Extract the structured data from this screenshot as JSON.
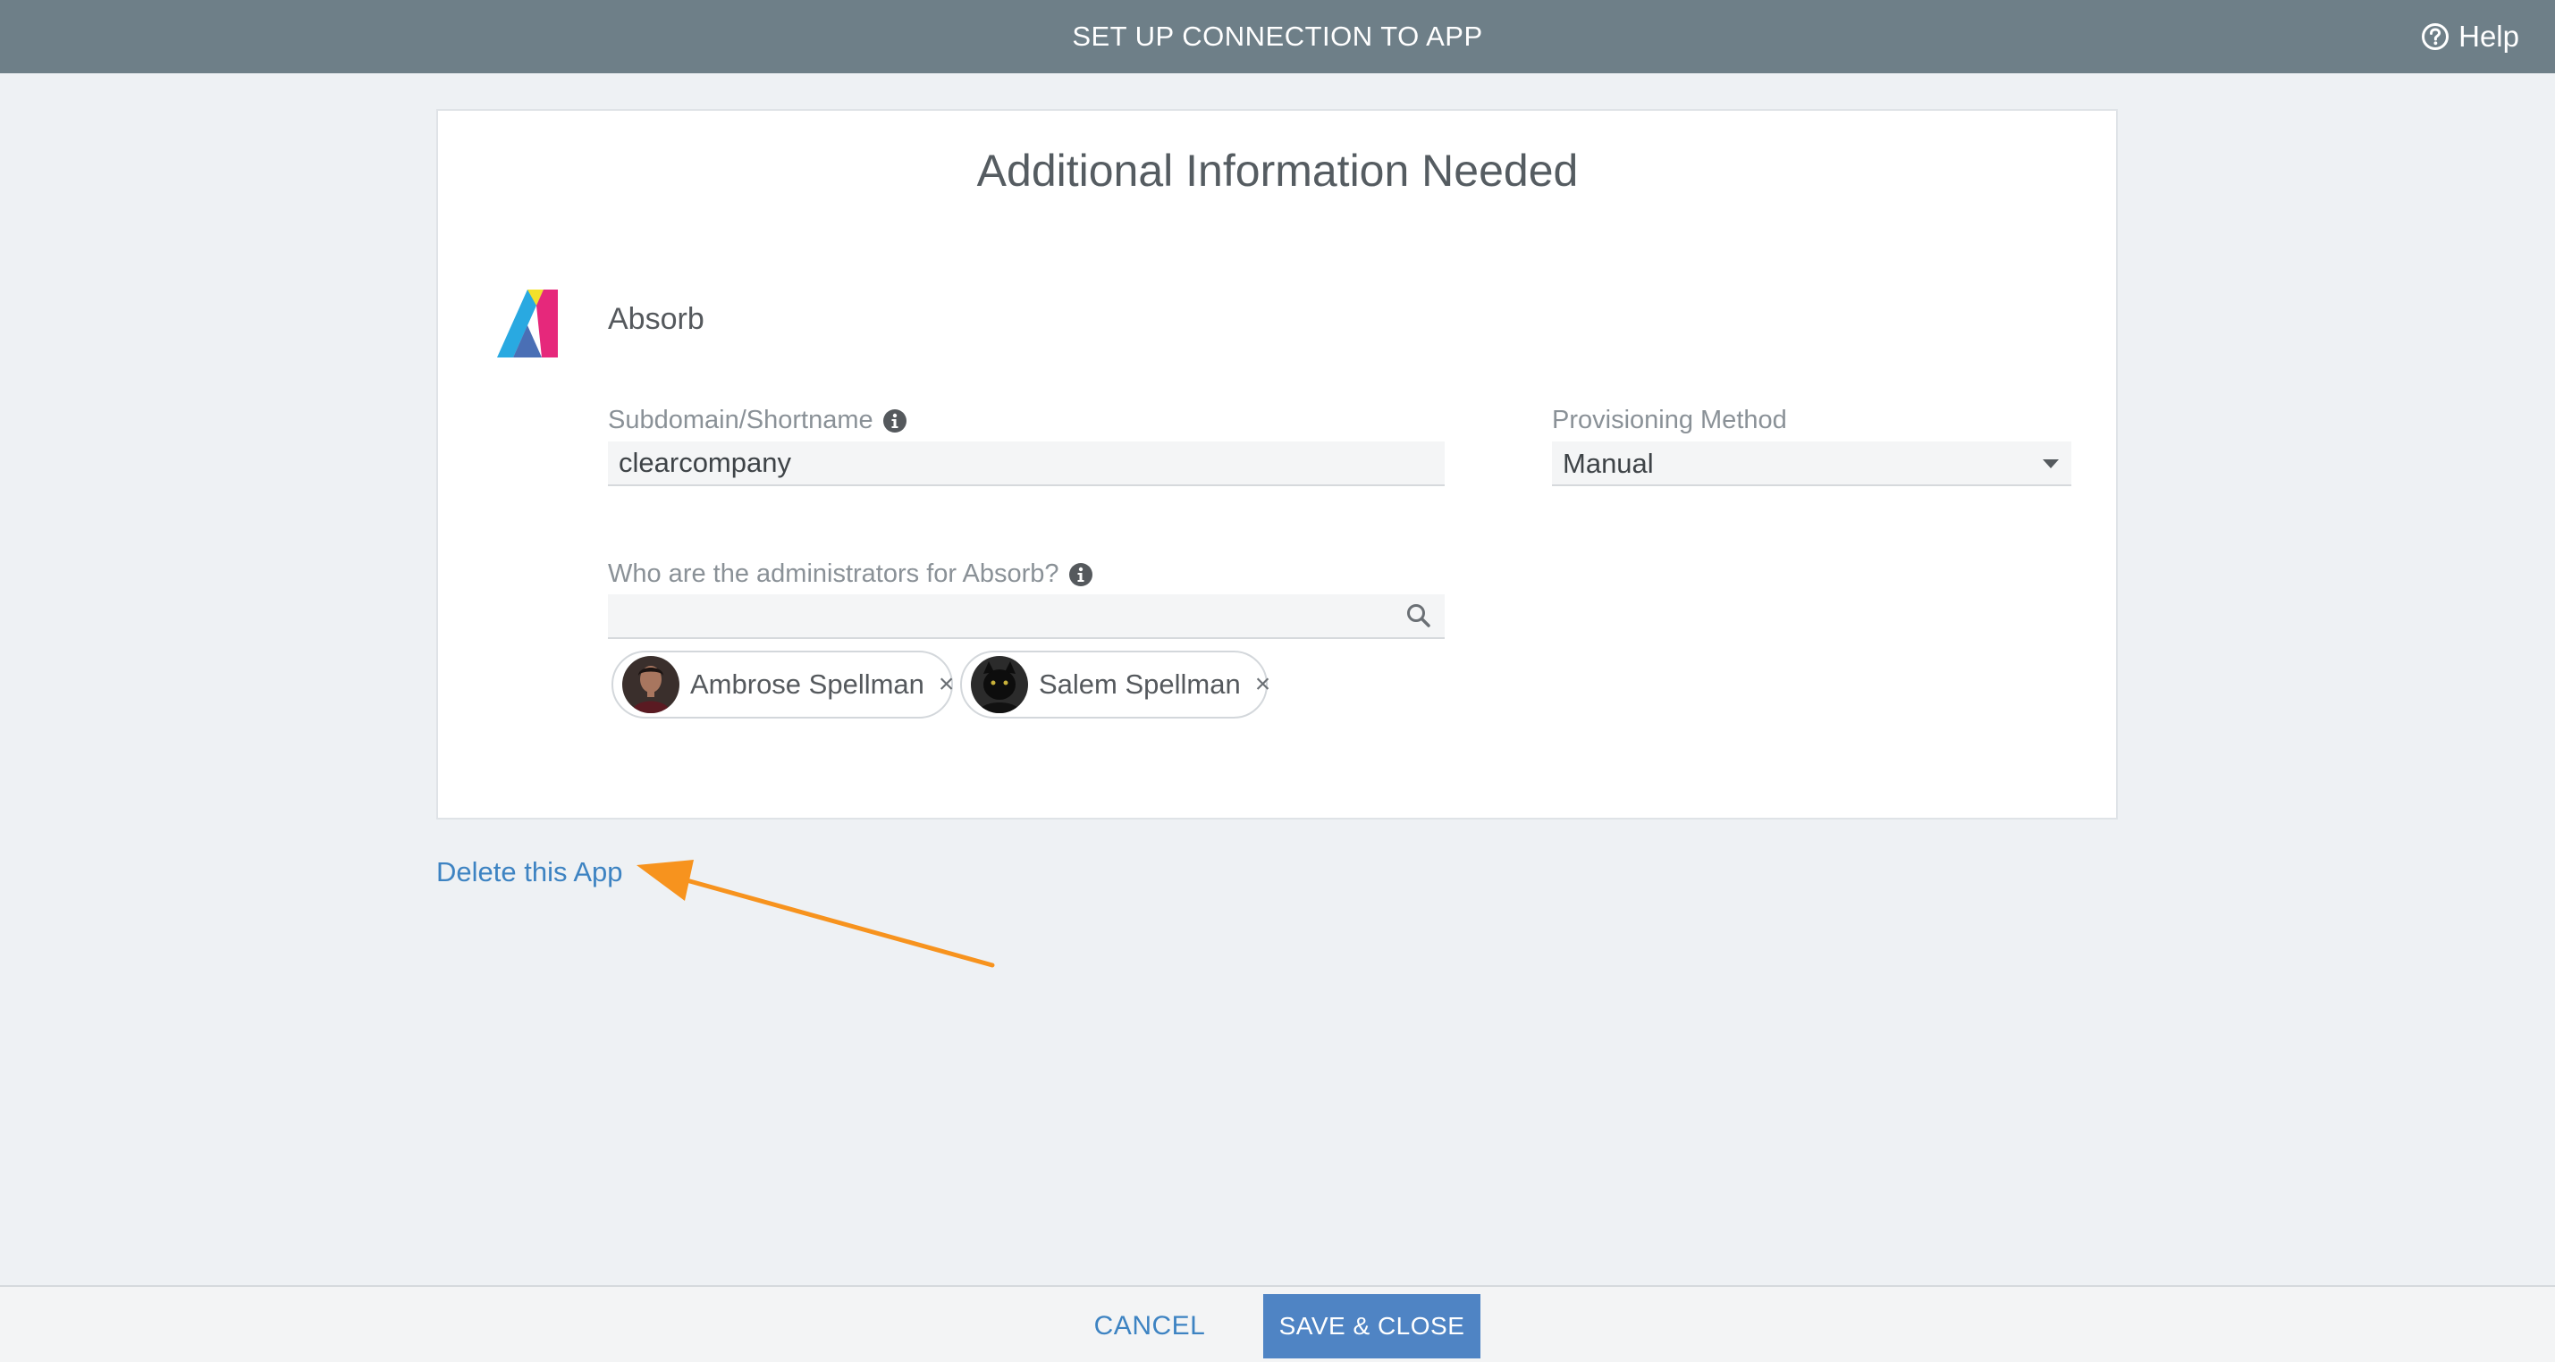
{
  "header": {
    "title": "SET UP CONNECTION TO APP",
    "help_label": "Help"
  },
  "card": {
    "heading": "Additional Information Needed",
    "app_name": "Absorb",
    "subdomain": {
      "label": "Subdomain/Shortname",
      "value": "clearcompany"
    },
    "provisioning": {
      "label": "Provisioning Method",
      "selected": "Manual"
    },
    "administrators": {
      "label": "Who are the administrators for Absorb?",
      "search_value": "",
      "selected": [
        {
          "name": "Ambrose Spellman",
          "remove_label": "×"
        },
        {
          "name": "Salem Spellman",
          "remove_label": "×"
        }
      ]
    }
  },
  "delete_link": "Delete this App",
  "footer": {
    "cancel_label": "CANCEL",
    "save_label": "SAVE & CLOSE"
  },
  "colors": {
    "header_bg": "#6e7f88",
    "link": "#3d83c2",
    "primary_button": "#4f84c4",
    "annotation_arrow": "#f7931e"
  }
}
